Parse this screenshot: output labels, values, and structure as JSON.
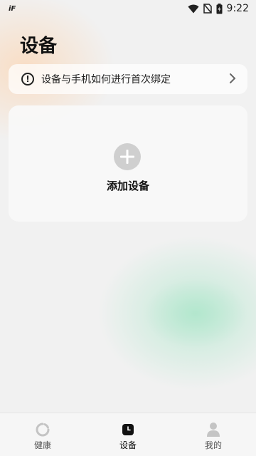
{
  "status_bar": {
    "carrier_badge": "iF",
    "time": "9:22",
    "icons": [
      "wifi-icon",
      "no-sim-icon",
      "battery-charging-icon"
    ]
  },
  "page": {
    "title": "设备"
  },
  "bind_help": {
    "text": "设备与手机如何进行首次绑定",
    "icon": "info-icon",
    "trailing_icon": "chevron-right-icon"
  },
  "add_device": {
    "label": "添加设备",
    "icon": "plus-icon"
  },
  "tabbar": {
    "tabs": [
      {
        "label": "健康",
        "icon": "health-ring-icon",
        "active": false
      },
      {
        "label": "设备",
        "icon": "watch-icon",
        "active": true
      },
      {
        "label": "我的",
        "icon": "person-icon",
        "active": false
      }
    ]
  },
  "colors": {
    "background": "#f1f1f1",
    "card": "#ffffff",
    "plus_circle": "#cfcfcf",
    "accent_warm": "#ffcda0",
    "accent_mint": "#a8e6c8",
    "inactive_icon": "#c4c4c4"
  }
}
